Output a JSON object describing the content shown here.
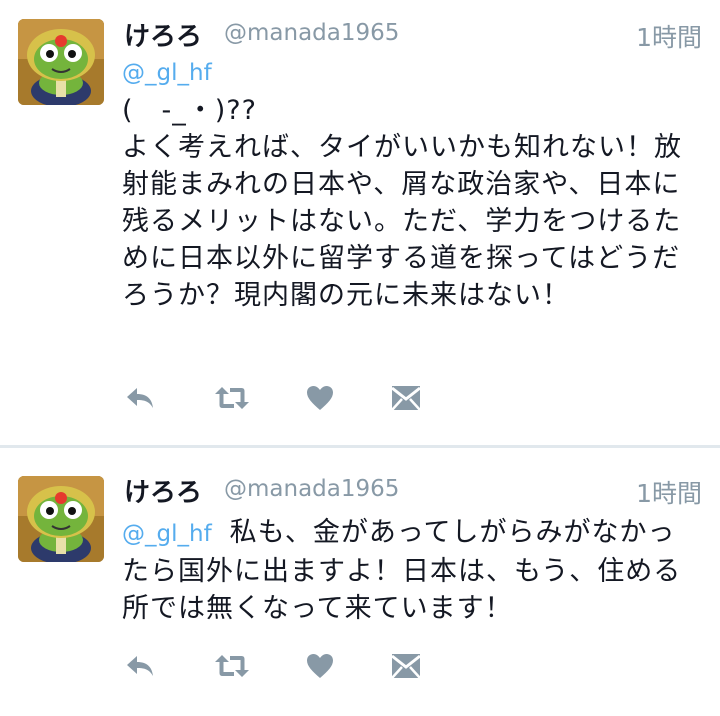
{
  "tweets": [
    {
      "name": "けろろ",
      "handle": "@manada1965",
      "time": "1時間",
      "mention": "@_gl_hf",
      "text": "(　-_・)??\nよく考えれば、タイがいいかも知れない！放射能まみれの日本や、屑な政治家や、日本に残るメリットはない。ただ、学力をつけるために日本以外に留学する道を探ってはどうだろうか？現内閣の元に未来はない！",
      "actions": [
        "reply-icon",
        "retweet-icon",
        "like-icon",
        "dm-icon"
      ]
    },
    {
      "name": "けろろ",
      "handle": "@manada1965",
      "time": "1時間",
      "mention": "@_gl_hf",
      "text": "私も、金があってしがらみがなかったら国外に出ますよ！日本は、もう、住める所では無くなって来ています！",
      "actions": [
        "reply-icon",
        "retweet-icon",
        "like-icon",
        "dm-icon"
      ]
    }
  ],
  "colors": {
    "link": "#55acee",
    "meta": "#8899a6",
    "icon": "#8899a6",
    "divider": "#e1e8ed"
  }
}
